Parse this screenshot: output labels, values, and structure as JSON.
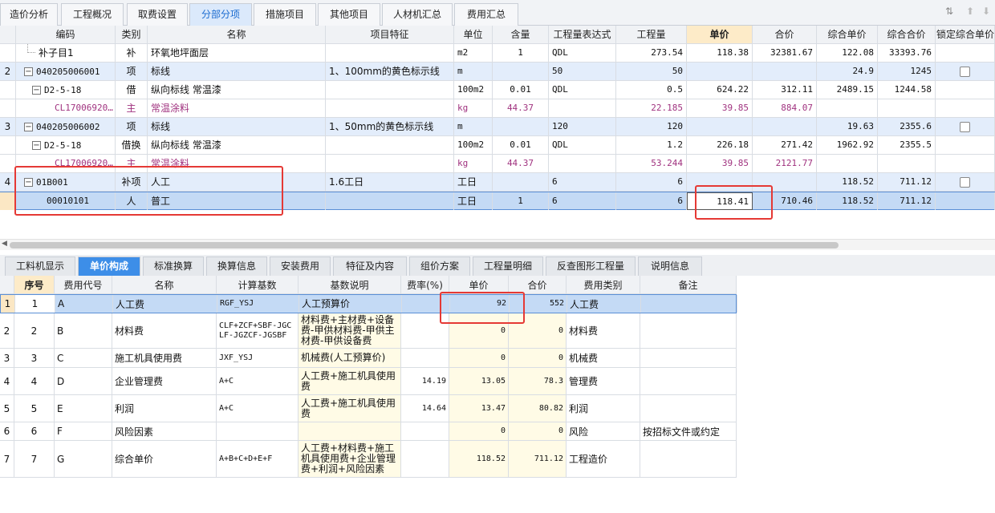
{
  "top_tabs": [
    {
      "label": "造价分析"
    },
    {
      "label": "工程概况"
    },
    {
      "label": "取费设置"
    },
    {
      "label": "分部分项"
    },
    {
      "label": "措施项目"
    },
    {
      "label": "其他项目"
    },
    {
      "label": "人材机汇总"
    },
    {
      "label": "费用汇总"
    }
  ],
  "top_columns": {
    "code": "编码",
    "category": "类别",
    "name": "名称",
    "feature": "项目特征",
    "unit": "单位",
    "content": "含量",
    "expr": "工程量表达式",
    "qty": "工程量",
    "unit_price": "单价",
    "total_price": "合价",
    "comp_unit_price": "综合单价",
    "comp_total_price": "综合合价",
    "lock": "锁定综合单价"
  },
  "top_rows": [
    {
      "no": "",
      "code": "补子目1",
      "category": "补",
      "name": "环氧地坪面层",
      "feature": "",
      "unit": "m2",
      "content": "1",
      "expr": "QDL",
      "qty": "273.54",
      "unit_price": "118.38",
      "total": "32381.67",
      "comp_unit": "122.08",
      "comp_total": "33393.76"
    },
    {
      "no": "2",
      "code": "040205006001",
      "category": "项",
      "name": "标线",
      "feature": "1、100mm的黄色标示线",
      "unit": "m",
      "content": "",
      "expr": "50",
      "qty": "50",
      "unit_price": "",
      "total": "",
      "comp_unit": "24.9",
      "comp_total": "1245"
    },
    {
      "no": "",
      "code": "D2-5-18",
      "category": "借",
      "name": "纵向标线 常温漆",
      "feature": "",
      "unit": "100m2",
      "content": "0.01",
      "expr": "QDL",
      "qty": "0.5",
      "unit_price": "624.22",
      "total": "312.11",
      "comp_unit": "2489.15",
      "comp_total": "1244.58"
    },
    {
      "no": "",
      "code": "CL17006920…",
      "category": "主",
      "name": "常温涂料",
      "feature": "",
      "unit": "kg",
      "content": "44.37",
      "expr": "",
      "qty": "22.185",
      "unit_price": "39.85",
      "total": "884.07",
      "comp_unit": "",
      "comp_total": ""
    },
    {
      "no": "3",
      "code": "040205006002",
      "category": "项",
      "name": "标线",
      "feature": "1、50mm的黄色标示线",
      "unit": "m",
      "content": "",
      "expr": "120",
      "qty": "120",
      "unit_price": "",
      "total": "",
      "comp_unit": "19.63",
      "comp_total": "2355.6"
    },
    {
      "no": "",
      "code": "D2-5-18",
      "category": "借换",
      "name": "纵向标线 常温漆",
      "feature": "",
      "unit": "100m2",
      "content": "0.01",
      "expr": "QDL",
      "qty": "1.2",
      "unit_price": "226.18",
      "total": "271.42",
      "comp_unit": "1962.92",
      "comp_total": "2355.5"
    },
    {
      "no": "",
      "code": "CL17006920…",
      "category": "主",
      "name": "常温涂料",
      "feature": "",
      "unit": "kg",
      "content": "44.37",
      "expr": "",
      "qty": "53.244",
      "unit_price": "39.85",
      "total": "2121.77",
      "comp_unit": "",
      "comp_total": ""
    },
    {
      "no": "4",
      "code": "01B001",
      "category": "补项",
      "name": "人工",
      "feature": "1.6工日",
      "unit": "工日",
      "content": "",
      "expr": "6",
      "qty": "6",
      "unit_price": "",
      "total": "",
      "comp_unit": "118.52",
      "comp_total": "711.12"
    },
    {
      "no": "",
      "code": "00010101",
      "category": "人",
      "name": "普工",
      "feature": "",
      "unit": "工日",
      "content": "1",
      "expr": "6",
      "qty": "6",
      "unit_price": "118.41",
      "total": "710.46",
      "comp_unit": "118.52",
      "comp_total": "711.12"
    }
  ],
  "toggle_symbol": "−",
  "bottom_tabs": [
    {
      "label": "工料机显示"
    },
    {
      "label": "单价构成"
    },
    {
      "label": "标准换算"
    },
    {
      "label": "换算信息"
    },
    {
      "label": "安装费用"
    },
    {
      "label": "特征及内容"
    },
    {
      "label": "组价方案"
    },
    {
      "label": "工程量明细"
    },
    {
      "label": "反查图形工程量"
    },
    {
      "label": "说明信息"
    }
  ],
  "bottom_columns": {
    "seq": "序号",
    "fee_code": "费用代号",
    "name": "名称",
    "calc_base": "计算基数",
    "base_desc": "基数说明",
    "rate": "费率(%)",
    "unit_price": "单价",
    "total": "合价",
    "fee_type": "费用类别",
    "remark": "备注"
  },
  "bottom_rows": [
    {
      "row": "1",
      "seq": "1",
      "fee_code": "A",
      "name": "人工费",
      "calc_base": "RGF_YSJ",
      "base_desc": "人工预算价",
      "rate": "",
      "unit_price": "92",
      "total": "552",
      "fee_type": "人工费",
      "remark": ""
    },
    {
      "row": "2",
      "seq": "2",
      "fee_code": "B",
      "name": "材料费",
      "calc_base": "CLF+ZCF+SBF-JGCLF-JGZCF-JGSBF",
      "base_desc": "材料费+主材费+设备费-甲供材料费-甲供主材费-甲供设备费",
      "rate": "",
      "unit_price": "0",
      "total": "0",
      "fee_type": "材料费",
      "remark": ""
    },
    {
      "row": "3",
      "seq": "3",
      "fee_code": "C",
      "name": "施工机具使用费",
      "calc_base": "JXF_YSJ",
      "base_desc": "机械费(人工预算价)",
      "rate": "",
      "unit_price": "0",
      "total": "0",
      "fee_type": "机械费",
      "remark": ""
    },
    {
      "row": "4",
      "seq": "4",
      "fee_code": "D",
      "name": "企业管理费",
      "calc_base": "A+C",
      "base_desc": "人工费+施工机具使用费",
      "rate": "14.19",
      "unit_price": "13.05",
      "total": "78.3",
      "fee_type": "管理费",
      "remark": ""
    },
    {
      "row": "5",
      "seq": "5",
      "fee_code": "E",
      "name": "利润",
      "calc_base": "A+C",
      "base_desc": "人工费+施工机具使用费",
      "rate": "14.64",
      "unit_price": "13.47",
      "total": "80.82",
      "fee_type": "利润",
      "remark": ""
    },
    {
      "row": "6",
      "seq": "6",
      "fee_code": "F",
      "name": "风险因素",
      "calc_base": "",
      "base_desc": "",
      "rate": "",
      "unit_price": "0",
      "total": "0",
      "fee_type": "风险",
      "remark": "按招标文件或约定"
    },
    {
      "row": "7",
      "seq": "7",
      "fee_code": "G",
      "name": "综合单价",
      "calc_base": "A+B+C+D+E+F",
      "base_desc": "人工费+材料费+施工机具使用费+企业管理费+利润+风险因素",
      "rate": "",
      "unit_price": "118.52",
      "total": "711.12",
      "fee_type": "工程造价",
      "remark": ""
    }
  ],
  "colors": {
    "accent": "#3d8ee8",
    "highlight_box": "#e53935",
    "main_material_text": "#a0327f"
  },
  "icons": [
    "filter-icon",
    "arrow-up-icon",
    "arrow-down-icon"
  ]
}
